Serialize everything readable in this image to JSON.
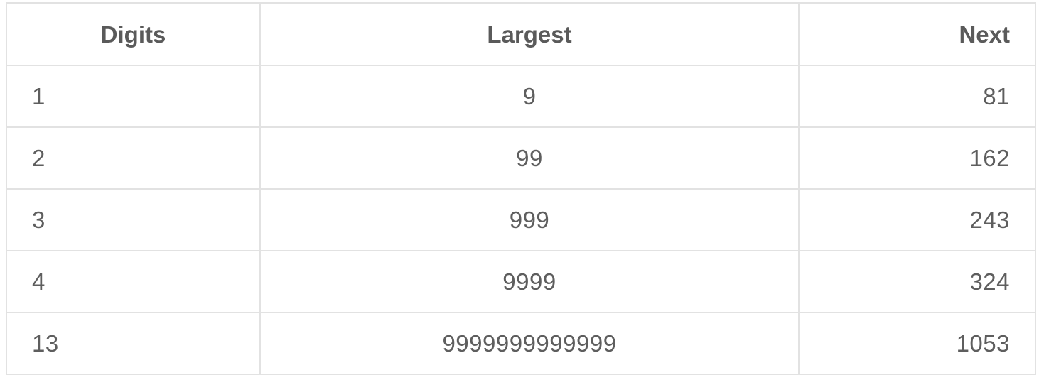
{
  "table": {
    "headers": [
      "Digits",
      "Largest",
      "Next"
    ],
    "rows": [
      [
        "1",
        "9",
        "81"
      ],
      [
        "2",
        "99",
        "162"
      ],
      [
        "3",
        "999",
        "243"
      ],
      [
        "4",
        "9999",
        "324"
      ],
      [
        "13",
        "9999999999999",
        "1053"
      ]
    ]
  }
}
